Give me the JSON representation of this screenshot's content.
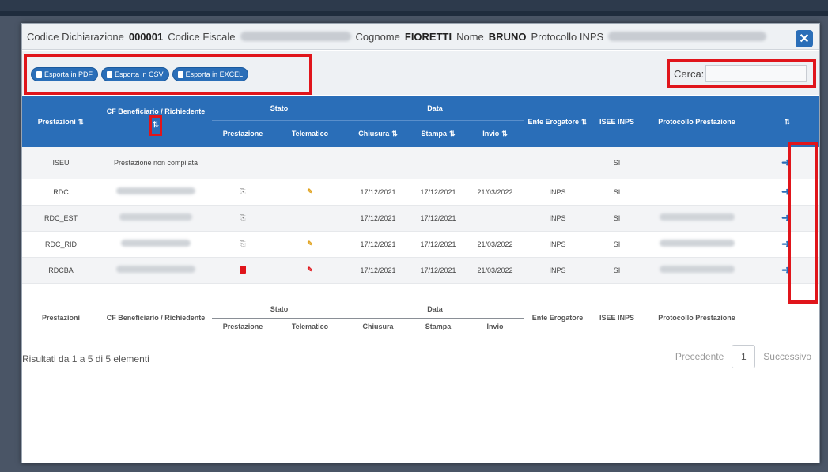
{
  "header": {
    "codice_dichiarazione_label": "Codice Dichiarazione",
    "codice_dichiarazione_value": "000001",
    "codice_fiscale_label": "Codice Fiscale",
    "cognome_label": "Cognome",
    "cognome_value": "FIORETTI",
    "nome_label": "Nome",
    "nome_value": "BRUNO",
    "protocollo_label": "Protocollo INPS",
    "close_icon": "close-icon"
  },
  "toolbar": {
    "export_pdf": "Esporta in PDF",
    "export_csv": "Esporta in CSV",
    "export_excel": "Esporta in EXCEL",
    "search_label": "Cerca:",
    "search_value": ""
  },
  "table": {
    "headers": {
      "prestazioni": "Prestazioni",
      "cf_beneficiario": "CF Beneficiario / Richiedente",
      "stato": "Stato",
      "data": "Data",
      "ente": "Ente Erogatore",
      "isee": "ISEE INPS",
      "protocollo": "Protocollo Prestazione",
      "prestazione": "Prestazione",
      "telematico": "Telematico",
      "chiusura": "Chiusura",
      "stampa": "Stampa",
      "invio": "Invio"
    },
    "rows": [
      {
        "prestazione": "ISEU",
        "cf": "Prestazione non compilata",
        "stato_prest": "",
        "stato_tel": "",
        "chiusura": "",
        "stampa": "",
        "invio": "",
        "ente": "",
        "isee": "SI"
      },
      {
        "prestazione": "RDC",
        "cf": "",
        "stato_prest": "doc",
        "stato_tel": "pen",
        "chiusura": "17/12/2021",
        "stampa": "17/12/2021",
        "invio": "21/03/2022",
        "ente": "INPS",
        "isee": "SI"
      },
      {
        "prestazione": "RDC_EST",
        "cf": "",
        "stato_prest": "doc",
        "stato_tel": "",
        "chiusura": "17/12/2021",
        "stampa": "17/12/2021",
        "invio": "",
        "ente": "INPS",
        "isee": "SI"
      },
      {
        "prestazione": "RDC_RID",
        "cf": "",
        "stato_prest": "doc",
        "stato_tel": "pen",
        "chiusura": "17/12/2021",
        "stampa": "17/12/2021",
        "invio": "21/03/2022",
        "ente": "INPS",
        "isee": "SI"
      },
      {
        "prestazione": "RDCBA",
        "cf": "",
        "stato_prest": "pdf",
        "stato_tel": "pen-red",
        "chiusura": "17/12/2021",
        "stampa": "17/12/2021",
        "invio": "21/03/2022",
        "ente": "INPS",
        "isee": "SI"
      }
    ]
  },
  "footer_headers": {
    "prestazioni": "Prestazioni",
    "cf_beneficiario": "CF Beneficiario / Richiedente",
    "stato": "Stato",
    "data": "Data",
    "ente": "Ente Erogatore",
    "isee": "ISEE INPS",
    "protocollo": "Protocollo Prestazione",
    "prestazione": "Prestazione",
    "telematico": "Telematico",
    "chiusura": "Chiusura",
    "stampa": "Stampa",
    "invio": "Invio"
  },
  "pagination": {
    "info": "Risultati da 1 a 5 di 5 elementi",
    "prev": "Precedente",
    "page": "1",
    "next": "Successivo"
  },
  "colors": {
    "accent": "#2a6eb8",
    "highlight": "#e0151b"
  }
}
